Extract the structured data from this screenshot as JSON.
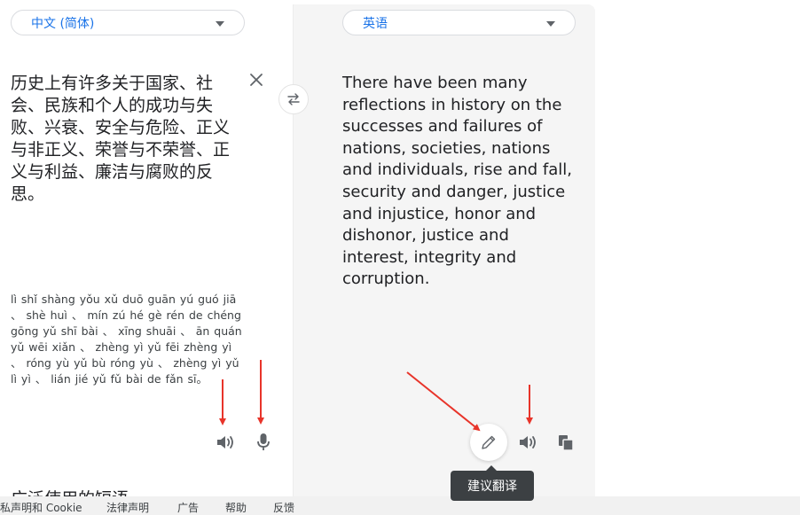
{
  "source": {
    "language": "中文 (简体)",
    "text": "历史上有许多关于国家、社会、民族和个人的成功与失败、兴衰、安全与危险、正义与非正义、荣誉与不荣誉、正义与利益、廉洁与腐败的反思。",
    "pinyin": "lì shǐ shàng yǒu xǔ duō guān yú guó jiā 、 shè huì 、 mín zú hé gè rén de chéng gōng yǔ shī bài 、 xīng shuāi 、 ān quán yǔ wēi xiǎn 、 zhèng yì yǔ fēi zhèng yì 、 róng yù yǔ bù róng yù 、 zhèng yì yǔ lì yì 、 lián jié yǔ fǔ bài de fǎn sī。"
  },
  "target": {
    "language": "英语",
    "text": "There have been many reflections in history on the successes and failures of nations, societies, nations and individuals, rise and fall, security and danger, justice and injustice, honor and dishonor, justice and interest, integrity and corruption."
  },
  "tooltip": {
    "label": "建议翻译"
  },
  "phrases": {
    "heading": "广泛使用的短语"
  },
  "footer": {
    "links": [
      "私声明和 Cookie",
      "法律声明",
      "广告",
      "帮助",
      "反馈"
    ]
  },
  "icons": {
    "clear": "close-icon",
    "swap": "swap-icon",
    "speaker": "speaker-icon",
    "mic": "microphone-icon",
    "edit": "pencil-icon",
    "copy": "copy-icon"
  },
  "colors": {
    "accent": "#1a73e8",
    "annotation": "#e8342a",
    "tooltip_bg": "#3c4043"
  }
}
